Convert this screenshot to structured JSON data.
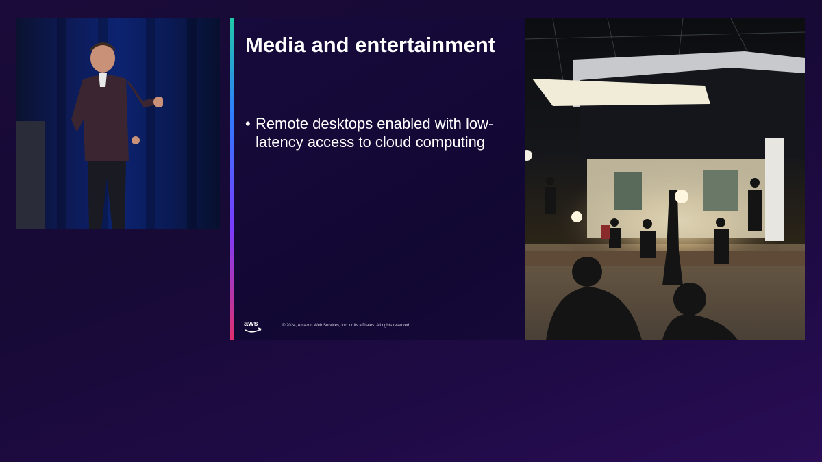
{
  "slide": {
    "title": "Media and entertainment",
    "bullets": [
      "Remote desktops enabled with low-latency access to cloud computing"
    ],
    "logo_text": "aws",
    "copyright": "© 2024, Amazon Web Services, Inc. or its affiliates. All rights reserved."
  },
  "colors": {
    "background": "#1a0b3a",
    "slide_background": "#140936",
    "accent_gradient": [
      "#20c9a8",
      "#2f7cff",
      "#7a3cff",
      "#e0306d"
    ],
    "aws_smile": "#ff9900"
  }
}
